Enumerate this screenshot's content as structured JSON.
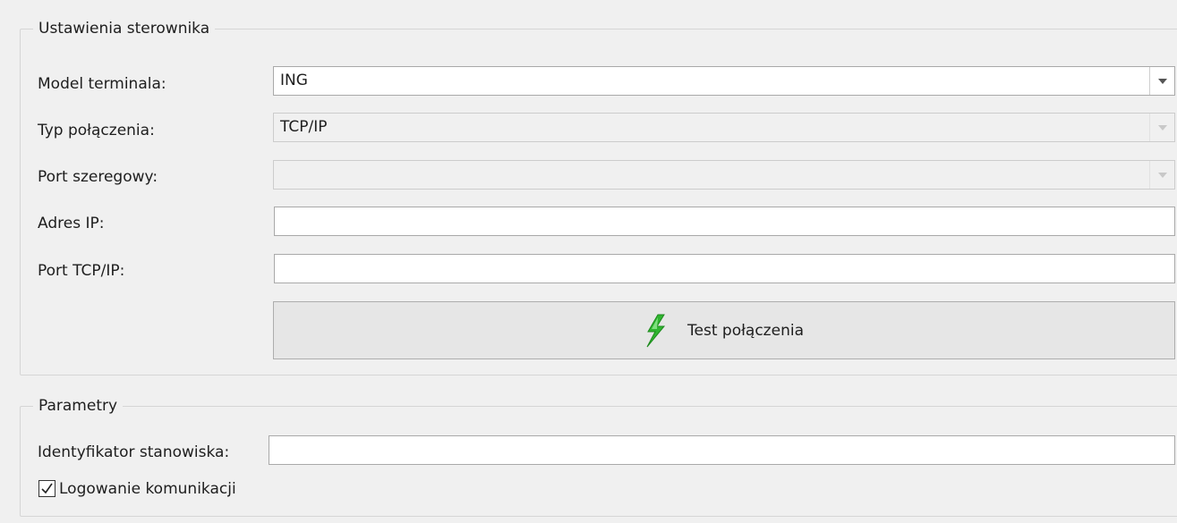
{
  "driver_settings": {
    "legend": "Ustawienia sterownika",
    "terminal_model": {
      "label": "Model terminala:",
      "value": "ING"
    },
    "connection_type": {
      "label": "Typ połączenia:",
      "value": "TCP/IP"
    },
    "serial_port": {
      "label": "Port szeregowy:",
      "value": ""
    },
    "ip_address": {
      "label": "Adres IP:",
      "value": ""
    },
    "tcp_port": {
      "label": "Port TCP/IP:",
      "value": ""
    },
    "test_button": {
      "label": "Test połączenia",
      "icon": "lightning-icon",
      "icon_color": "#2fb52f"
    }
  },
  "parameters": {
    "legend": "Parametry",
    "station_id": {
      "label": "Identyfikator stanowiska:",
      "value": ""
    },
    "logging": {
      "label": "Logowanie komunikacji",
      "checked": true
    }
  }
}
